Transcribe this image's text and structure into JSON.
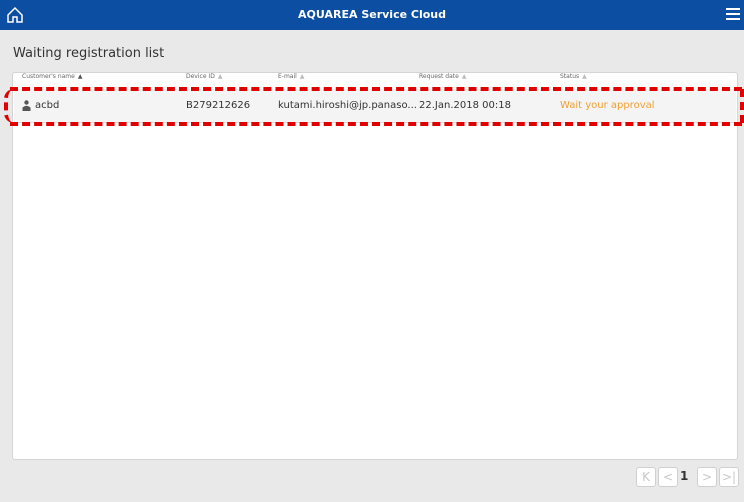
{
  "header": {
    "title": "AQUAREA Service Cloud",
    "home_icon": "home-icon",
    "menu_icon": "hamburger-menu-icon",
    "bg_color": "#0b4ea2"
  },
  "page": {
    "title": "Waiting registration list"
  },
  "table": {
    "columns": [
      "Customer's name",
      "Device ID",
      "E-mail",
      "Request date",
      "Status"
    ],
    "rows": [
      {
        "customer": "acbd",
        "device_id": "B279212626",
        "email": "kutami.hiroshi@jp.panaso...",
        "request_date": "22.Jan.2018 00:18",
        "status": "Wait your approval"
      }
    ],
    "sort_icon": "sort-icon",
    "status_color": "#f0a030",
    "highlight_color": "#e00000"
  },
  "pagination": {
    "current_page": "1",
    "first_label": "K",
    "prev_label": "<",
    "next_label": ">",
    "last_label": ">|"
  }
}
